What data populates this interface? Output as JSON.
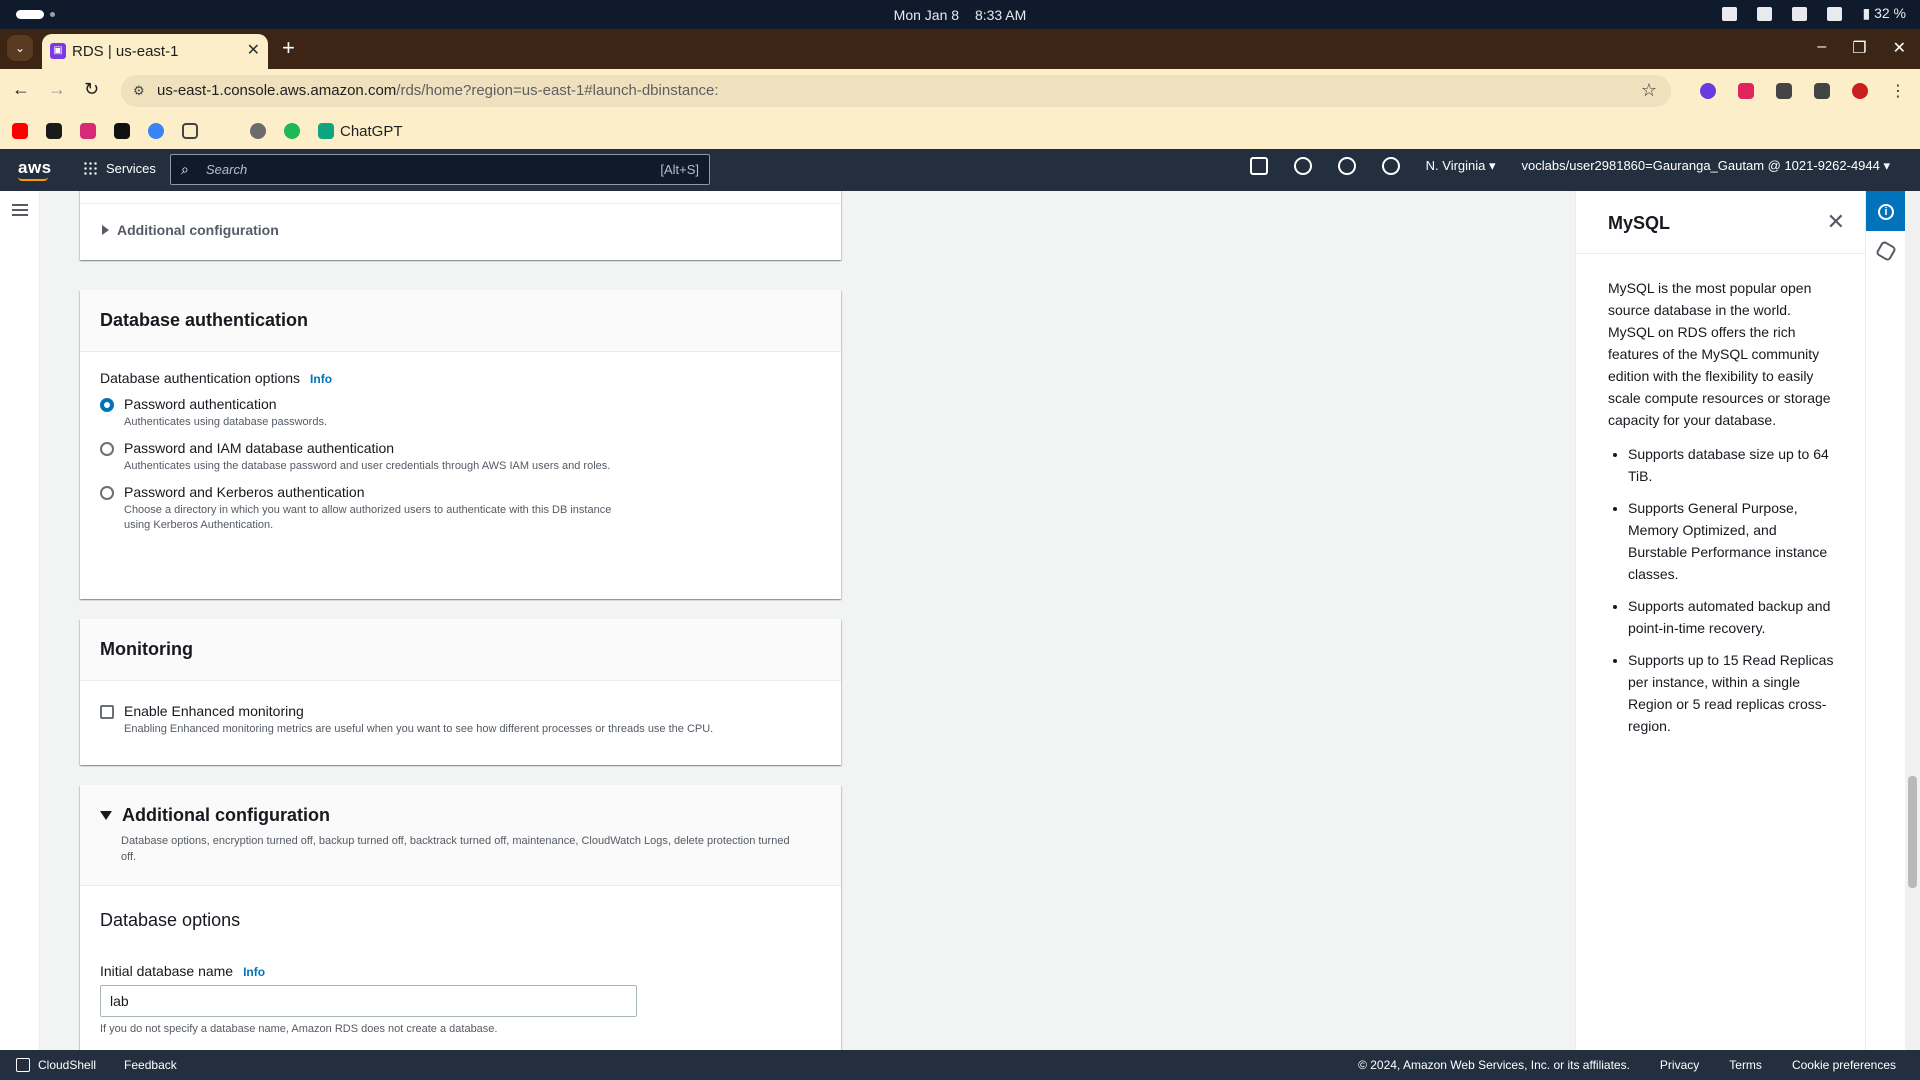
{
  "os": {
    "date": "Mon Jan 8",
    "time": "8:33 AM",
    "battery": "32 %"
  },
  "browser": {
    "tab_title": "RDS | us-east-1",
    "url_host": "us-east-1.console.aws.amazon.com",
    "url_path": "/rds/home?region=us-east-1#launch-dbinstance:",
    "bookmarks": {
      "chatgpt": "ChatGPT"
    }
  },
  "aws_nav": {
    "logo": "aws",
    "services": "Services",
    "search_placeholder": "Search",
    "search_shortcut": "[Alt+S]",
    "region": "N. Virginia",
    "account": "voclabs/user2981860=Gauranga_Gautam @ 1021-9262-4944"
  },
  "form": {
    "top_panel": {
      "expander_label": "Additional configuration"
    },
    "db_auth": {
      "title": "Database authentication",
      "options_label": "Database authentication options",
      "info": "Info",
      "options": [
        {
          "title": "Password authentication",
          "desc": "Authenticates using database passwords.",
          "checked": true
        },
        {
          "title": "Password and IAM database authentication",
          "desc": "Authenticates using the database password and user credentials through AWS IAM users and roles.",
          "checked": false
        },
        {
          "title": "Password and Kerberos authentication",
          "desc": "Choose a directory in which you want to allow authorized users to authenticate with this DB instance using Kerberos Authentication.",
          "checked": false
        }
      ]
    },
    "monitoring": {
      "title": "Monitoring",
      "checkbox_label": "Enable Enhanced monitoring",
      "checkbox_desc": "Enabling Enhanced monitoring metrics are useful when you want to see how different processes or threads use the CPU.",
      "checked": false
    },
    "additional": {
      "title": "Additional configuration",
      "desc": "Database options, encryption turned off, backup turned off, backtrack turned off, maintenance, CloudWatch Logs, delete protection turned off.",
      "db_options_title": "Database options",
      "initial_db_label": "Initial database name",
      "info": "Info",
      "initial_db_value": "lab",
      "initial_db_hint": "If you do not specify a database name, Amazon RDS does not create a database."
    }
  },
  "help_panel": {
    "title": "MySQL",
    "intro": "MySQL is the most popular open source database in the world. MySQL on RDS offers the rich features of the MySQL community edition with the flexibility to easily scale compute resources or storage capacity for your database.",
    "bullets": [
      "Supports database size up to 64 TiB.",
      "Supports General Purpose, Memory Optimized, and Burstable Performance instance classes.",
      "Supports automated backup and point-in-time recovery.",
      "Supports up to 15 Read Replicas per instance, within a single Region or 5 read replicas cross-region."
    ]
  },
  "footer": {
    "cloudshell": "CloudShell",
    "feedback": "Feedback",
    "copyright": "© 2024, Amazon Web Services, Inc. or its affiliates.",
    "privacy": "Privacy",
    "terms": "Terms",
    "cookies": "Cookie preferences"
  }
}
